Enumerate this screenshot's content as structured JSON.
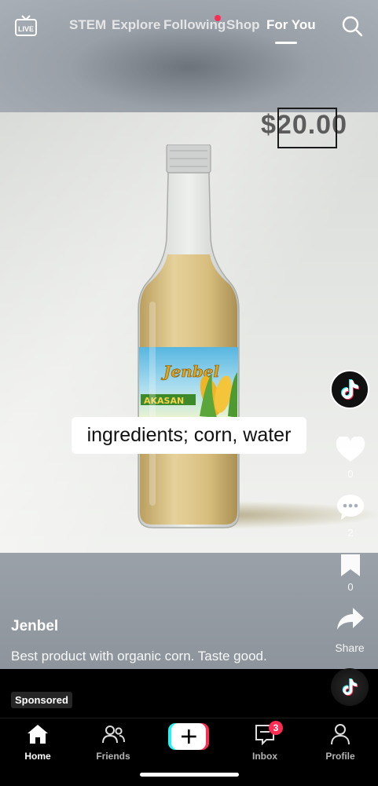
{
  "top_nav": {
    "live_label": "LIVE",
    "tabs": [
      {
        "label": "STEM"
      },
      {
        "label": "Explore"
      },
      {
        "label": "Following"
      },
      {
        "label": "Shop"
      },
      {
        "label": "For You"
      }
    ],
    "active_tab": "For You"
  },
  "video": {
    "price_text": "$20.00",
    "caption_text": "ingredients; corn, water",
    "bottle_label_brand": "Jenbel",
    "bottle_label_product": "AKASAN"
  },
  "actions": {
    "like_count": "0",
    "comment_count": "2",
    "save_count": "0",
    "share_label": "Share"
  },
  "post": {
    "username": "Jenbel",
    "description": "Best product with organic corn. Taste good.",
    "sponsored_label": "Sponsored"
  },
  "bottom_nav": {
    "home": "Home",
    "friends": "Friends",
    "inbox": "Inbox",
    "inbox_badge": "3",
    "profile": "Profile"
  },
  "colors": {
    "accent_red": "#fe2c55",
    "accent_cyan": "#25f4ee"
  }
}
